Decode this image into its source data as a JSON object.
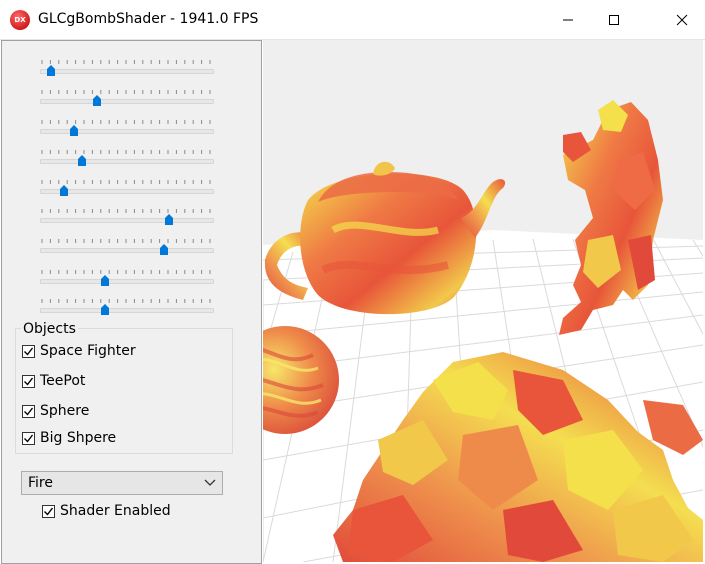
{
  "window": {
    "title": "GLCgBombShader - 1941.0 FPS",
    "icon_text": "DX",
    "controls": [
      "minimize-icon",
      "maximize-icon",
      "close-icon"
    ]
  },
  "sliders": [
    {
      "value": 0.04
    },
    {
      "value": 0.32
    },
    {
      "value": 0.18
    },
    {
      "value": 0.23
    },
    {
      "value": 0.12
    },
    {
      "value": 0.75
    },
    {
      "value": 0.72
    },
    {
      "value": 0.37
    },
    {
      "value": 0.37
    }
  ],
  "objects_group": {
    "title": "Objects",
    "items": [
      {
        "label": "Space Fighter",
        "checked": true
      },
      {
        "label": "TeePot",
        "checked": true
      },
      {
        "label": "Sphere",
        "checked": true
      },
      {
        "label": "Big Shpere",
        "checked": true
      }
    ]
  },
  "shader_select": {
    "value": "Fire"
  },
  "shader_enabled": {
    "label": "Shader Enabled",
    "checked": true
  },
  "colors": {
    "accent": "#0078d7",
    "panel_bg": "#f0f0f0",
    "viewport_bg": "#efefef",
    "fire_red": "#e8553a",
    "fire_yellow": "#f4e04a"
  }
}
